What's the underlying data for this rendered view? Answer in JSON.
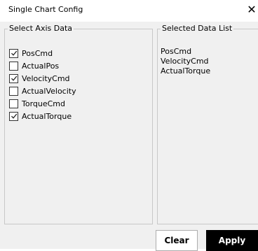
{
  "window": {
    "title": "Single Chart Config",
    "close_glyph": "✕"
  },
  "axis_group": {
    "legend": "Select Axis Data",
    "items": [
      {
        "label": "PosCmd",
        "checked": true
      },
      {
        "label": "ActualPos",
        "checked": false
      },
      {
        "label": "VelocityCmd",
        "checked": true
      },
      {
        "label": "ActualVelocity",
        "checked": false
      },
      {
        "label": "TorqueCmd",
        "checked": false
      },
      {
        "label": "ActualTorque",
        "checked": true
      }
    ]
  },
  "selected_group": {
    "legend": "Selected Data List",
    "items": [
      "PosCmd",
      "VelocityCmd",
      "ActualTorque"
    ]
  },
  "buttons": {
    "clear": "Clear",
    "apply": "Apply"
  }
}
